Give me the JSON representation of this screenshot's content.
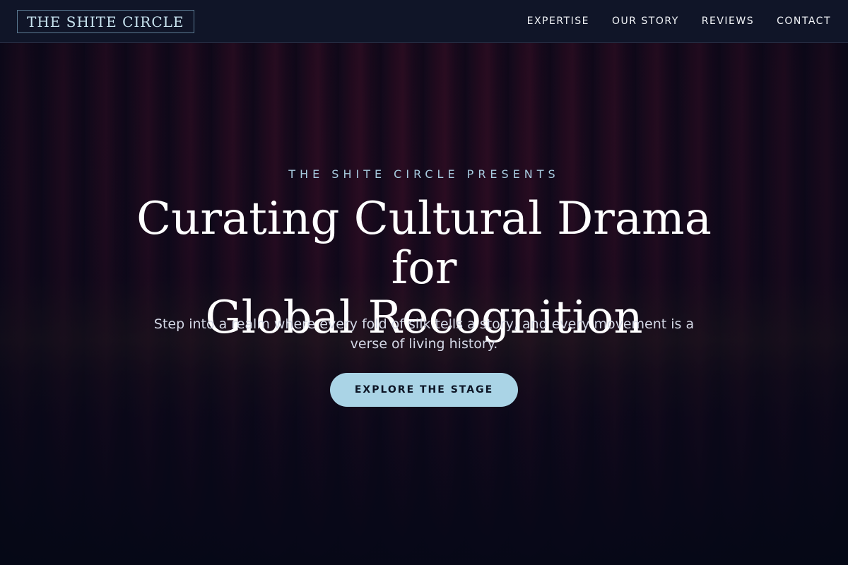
{
  "header": {
    "logo": "THE SHITE CIRCLE",
    "nav": [
      {
        "label": "EXPERTISE"
      },
      {
        "label": "OUR STORY"
      },
      {
        "label": "REVIEWS"
      },
      {
        "label": "CONTACT"
      }
    ]
  },
  "hero": {
    "eyebrow": "THE SHITE CIRCLE PRESENTS",
    "title_line1": "Curating Cultural Drama for",
    "title_line2": "Global Recognition",
    "subtitle": "Step into a realm where every fold of silk tells a story, and every movement is a verse of living history.",
    "cta_label": "EXPLORE THE STAGE"
  },
  "colors": {
    "header_bg": "#101528",
    "accent": "#aad4e6",
    "eyebrow": "#a8cce0",
    "page_bg": "#050816"
  }
}
